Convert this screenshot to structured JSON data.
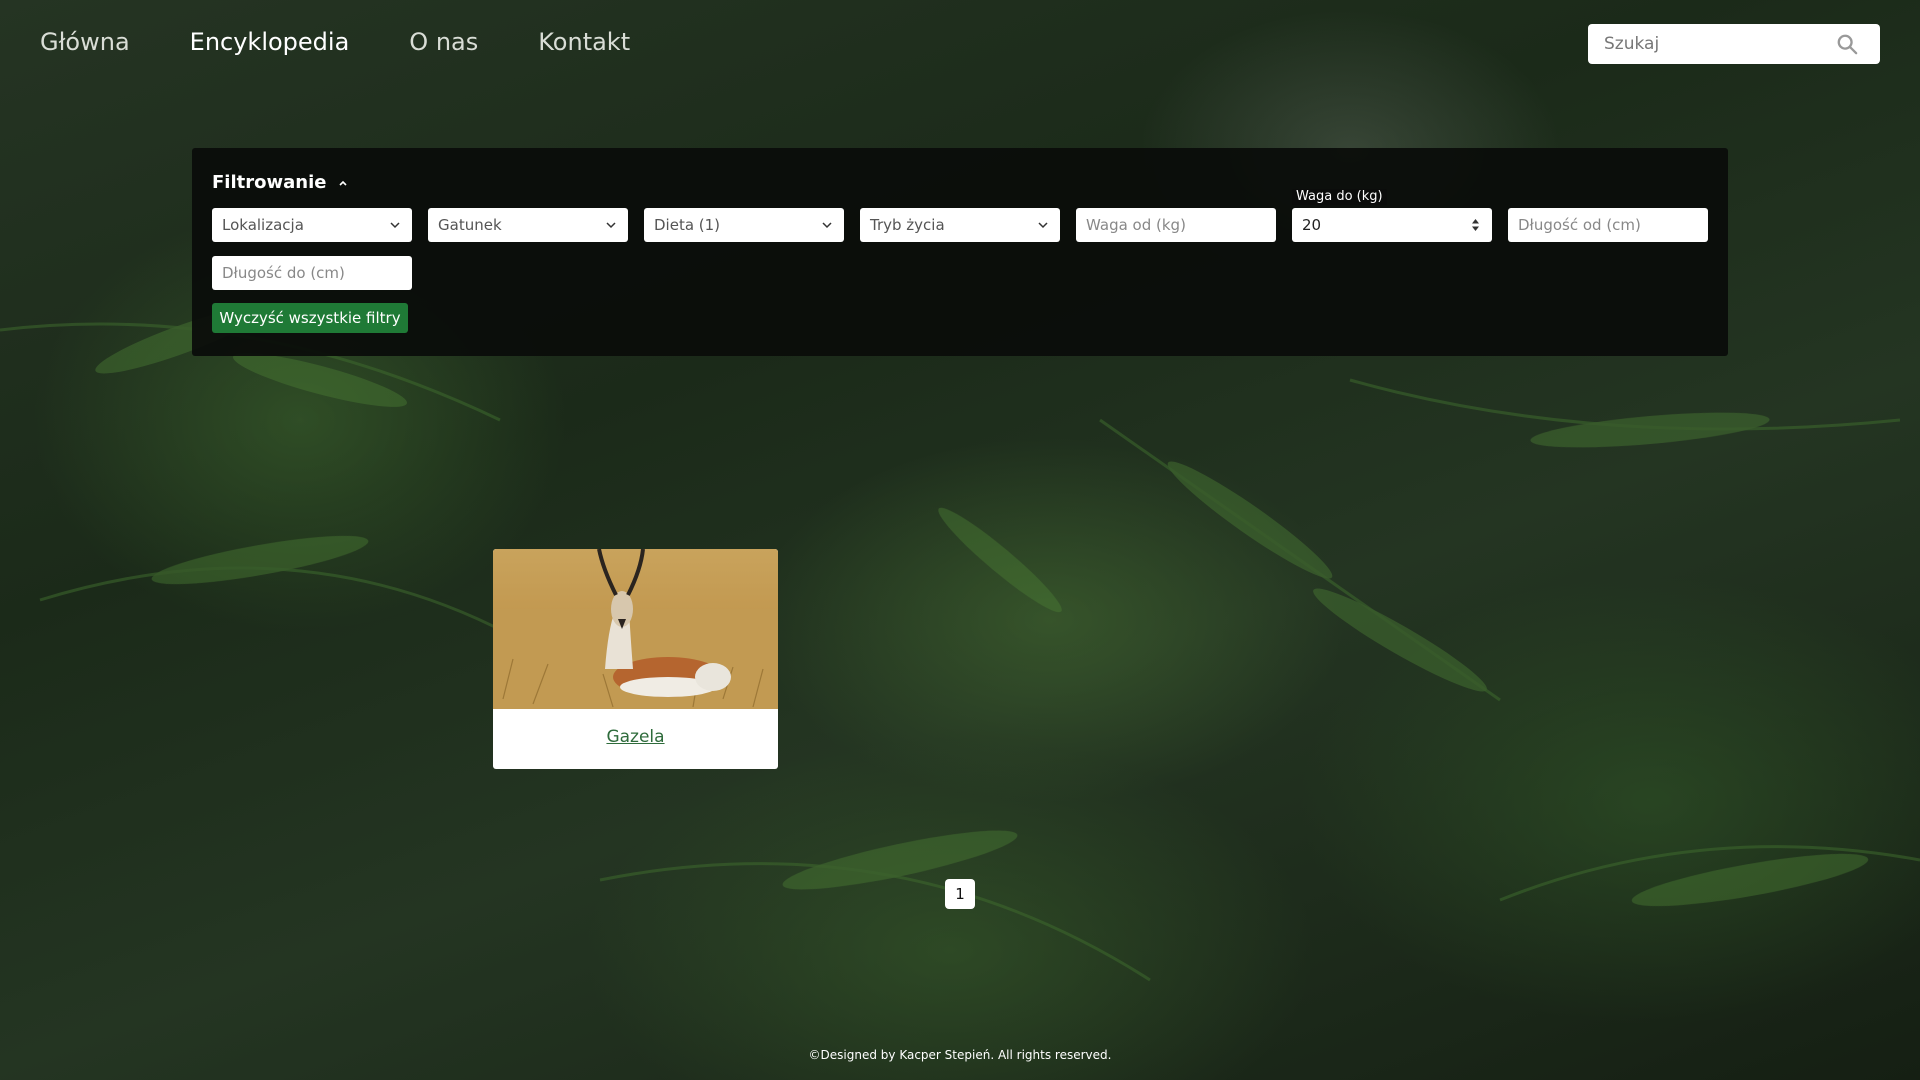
{
  "nav": {
    "items": [
      {
        "label": "Główna"
      },
      {
        "label": "Encyklopedia"
      },
      {
        "label": "O nas"
      },
      {
        "label": "Kontakt"
      }
    ],
    "active_index": 1
  },
  "search": {
    "placeholder": "Szukaj",
    "icon": "search-icon"
  },
  "filters": {
    "title": "Filtrowanie",
    "toggle_icon": "chevron-up-icon",
    "selects": [
      {
        "label": "Lokalizacja"
      },
      {
        "label": "Gatunek"
      },
      {
        "label": "Dieta (1)"
      },
      {
        "label": "Tryb życia"
      }
    ],
    "weight_from": {
      "placeholder": "Waga od (kg)"
    },
    "weight_to": {
      "label": "Waga do (kg)",
      "value": "20"
    },
    "length_from": {
      "placeholder": "Długość od (cm)"
    },
    "length_to": {
      "placeholder": "Długość do (cm)"
    },
    "clear_label": "Wyczyść wszystkie filtry"
  },
  "results": [
    {
      "name": "Gazela"
    }
  ],
  "pagination": {
    "current": "1"
  },
  "footer": {
    "text": "©Designed by Kacper Stepień. All rights reserved."
  },
  "colors": {
    "accent_button": "#1f7a36",
    "link": "#2e6b3b",
    "panel": "#0a0c0a"
  }
}
